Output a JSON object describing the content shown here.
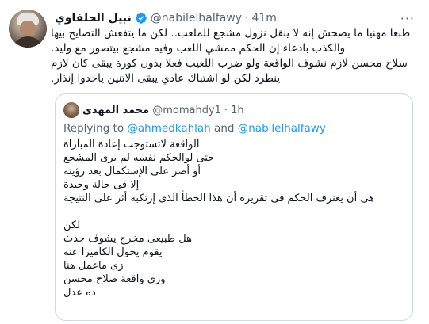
{
  "tweet": {
    "author_name": "نبيل الحلفاوي",
    "handle": "@nabilelhalfawy",
    "separator": "·",
    "time": "41m",
    "more_icon": "more-horizontal-icon",
    "verified_icon": "verified-badge-icon",
    "text_lines": [
      "طبعا مهنيا ما يصحش إنه لا ينقل نزول مشجع للملعب.. لكن ما يتفعش التصايح بيها",
      "والكذب  بادعاء إن الحكم ممشي اللعب وفيه مشجع بيتصور مع وليد.",
      "سلاح محسن لازم نشوف الواقعة ولو ضرب اللعيب فعلا بدون كورة يبقى كان لازم",
      "ينطرد لكن لو اشتباك عادي يبقى الاتنين ياخدوا إنذار."
    ]
  },
  "quoted_tweet": {
    "author_name": "محمد المهدى",
    "handle": "@momahdy1",
    "separator": "·",
    "time": "1h",
    "replying_prefix": "Replying to ",
    "mention_1": "@ahmedkahlah",
    "replying_and": " and ",
    "mention_2": "@nabilelhalfawy",
    "lines": [
      "الواقعة لاتستوجب إعادة المباراة",
      "حتى لوالحكم نفسه لم يرى المشجع",
      "أو أصر على الإستكمال بعد رؤيته",
      "إلا فى حالة وحيدة",
      "هى أن يعترف الحكم فى تقريره أن هذا الخطأ الذى إرتكبه أثر على النتيجة",
      "",
      "لكن",
      "هل طبيعى مخرج يشوف حدث",
      "يقوم يحول الكاميرا عنه",
      "زى ماعمل هنا",
      "وزى واقعة صلاح محسن",
      "ده عدل"
    ]
  },
  "colors": {
    "text": "#0f1419",
    "secondary": "#536471",
    "link": "#1d9bf0",
    "border": "#cfd9de"
  }
}
